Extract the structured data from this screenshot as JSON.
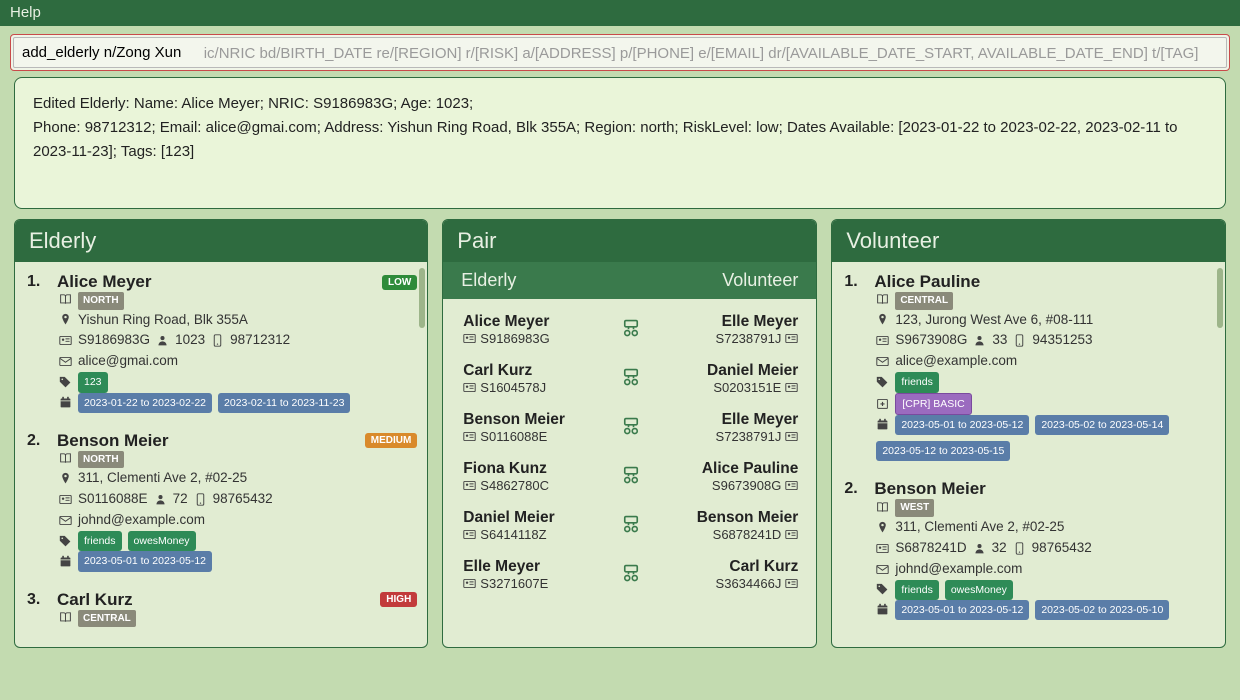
{
  "menubar": {
    "help": "Help"
  },
  "command": {
    "value": "add_elderly n/Zong Xun ",
    "placeholder_tail": "ic/NRIC bd/BIRTH_DATE re/[REGION] r/[RISK] a/[ADDRESS] p/[PHONE] e/[EMAIL] dr/[AVAILABLE_DATE_START, AVAILABLE_DATE_END] t/[TAG]"
  },
  "result": {
    "line1": "Edited Elderly: Name: Alice Meyer; NRIC: S9186983G; Age: 1023;",
    "line2": "Phone: 98712312; Email: alice@gmai.com; Address: Yishun Ring Road, Blk 355A; Region: north; RiskLevel: low; Dates Available: [2023-01-22 to 2023-02-22, 2023-02-11 to 2023-11-23]; Tags: [123]"
  },
  "headers": {
    "elderly": "Elderly",
    "pair": "Pair",
    "volunteer": "Volunteer",
    "pair_left": "Elderly",
    "pair_right": "Volunteer"
  },
  "risk_labels": {
    "low": "LOW",
    "medium": "MEDIUM",
    "high": "HIGH"
  },
  "elderly": [
    {
      "num": "1.",
      "name": "Alice Meyer",
      "risk": "low",
      "region": "NORTH",
      "address": "Yishun Ring Road, Blk 355A",
      "nric": "S9186983G",
      "age": "1023",
      "phone": "98712312",
      "email": "alice@gmai.com",
      "tags": [
        {
          "text": "123",
          "cls": "tag-green"
        }
      ],
      "dates": [
        "2023-01-22 to 2023-02-22",
        "2023-02-11 to 2023-11-23"
      ]
    },
    {
      "num": "2.",
      "name": "Benson Meier",
      "risk": "medium",
      "region": "NORTH",
      "address": "311, Clementi Ave 2, #02-25",
      "nric": "S0116088E",
      "age": "72",
      "phone": "98765432",
      "email": "johnd@example.com",
      "tags": [
        {
          "text": "friends",
          "cls": "tag-green"
        },
        {
          "text": "owesMoney",
          "cls": "tag-green"
        }
      ],
      "dates": [
        "2023-05-01 to 2023-05-12"
      ]
    },
    {
      "num": "3.",
      "name": "Carl Kurz",
      "risk": "high",
      "region": "CENTRAL"
    }
  ],
  "pairs": [
    {
      "e_name": "Alice Meyer",
      "e_nric": "S9186983G",
      "v_name": "Elle Meyer",
      "v_nric": "S7238791J"
    },
    {
      "e_name": "Carl Kurz",
      "e_nric": "S1604578J",
      "v_name": "Daniel Meier",
      "v_nric": "S0203151E"
    },
    {
      "e_name": "Benson Meier",
      "e_nric": "S0116088E",
      "v_name": "Elle Meyer",
      "v_nric": "S7238791J"
    },
    {
      "e_name": "Fiona Kunz",
      "e_nric": "S4862780C",
      "v_name": "Alice Pauline",
      "v_nric": "S9673908G"
    },
    {
      "e_name": "Daniel Meier",
      "e_nric": "S6414118Z",
      "v_name": "Benson Meier",
      "v_nric": "S6878241D"
    },
    {
      "e_name": "Elle Meyer",
      "e_nric": "S3271607E",
      "v_name": "Carl Kurz",
      "v_nric": "S3634466J"
    }
  ],
  "volunteers": [
    {
      "num": "1.",
      "name": "Alice Pauline",
      "region": "CENTRAL",
      "address": "123, Jurong West Ave 6, #08-111",
      "nric": "S9673908G",
      "age": "33",
      "phone": "94351253",
      "email": "alice@example.com",
      "tags": [
        {
          "text": "friends",
          "cls": "tag-green"
        }
      ],
      "med": [
        {
          "text": "[CPR] BASIC",
          "cls": "tag-purple"
        }
      ],
      "dates": [
        "2023-05-01 to 2023-05-12",
        "2023-05-02 to 2023-05-14",
        "2023-05-12 to 2023-05-15"
      ]
    },
    {
      "num": "2.",
      "name": "Benson Meier",
      "region": "WEST",
      "address": "311, Clementi Ave 2, #02-25",
      "nric": "S6878241D",
      "age": "32",
      "phone": "98765432",
      "email": "johnd@example.com",
      "tags": [
        {
          "text": "friends",
          "cls": "tag-green"
        },
        {
          "text": "owesMoney",
          "cls": "tag-green"
        }
      ],
      "dates": [
        "2023-05-01 to 2023-05-12",
        "2023-05-02 to 2023-05-10"
      ]
    }
  ]
}
